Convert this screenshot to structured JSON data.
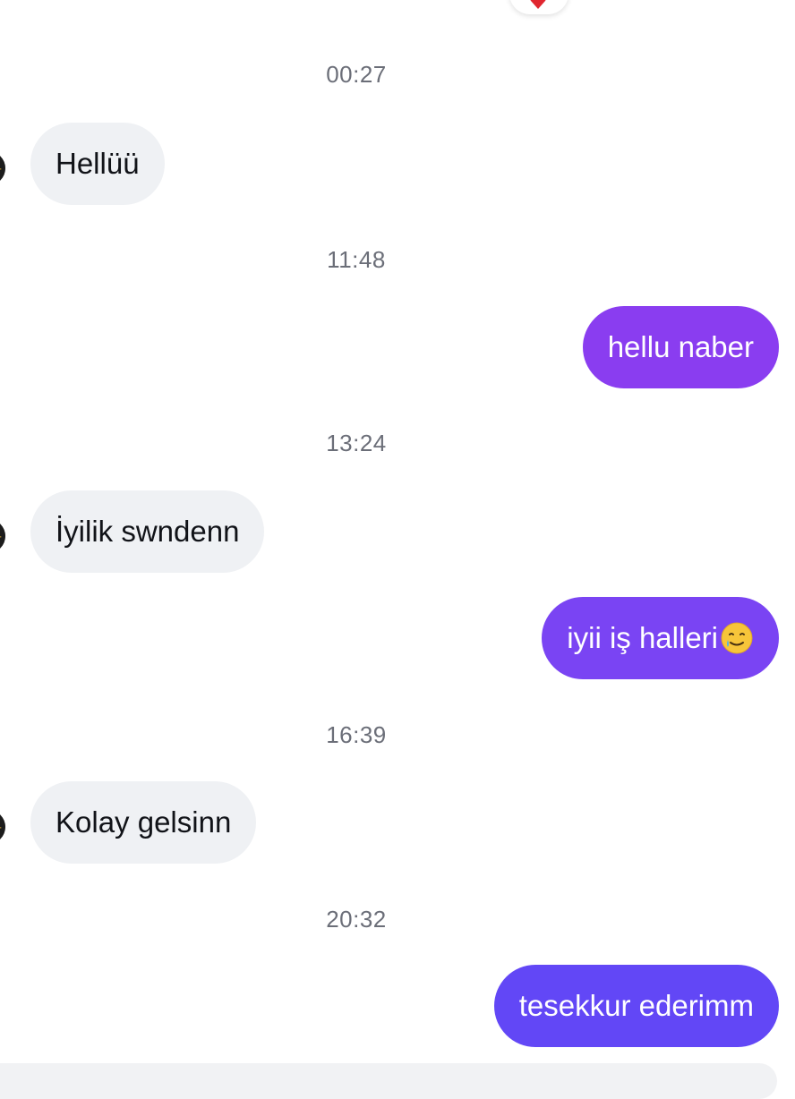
{
  "conversation": {
    "items": [
      {
        "type": "timestamp",
        "text": "00:27"
      },
      {
        "type": "incoming",
        "text": "Hellüü"
      },
      {
        "type": "timestamp",
        "text": "11:48"
      },
      {
        "type": "outgoing",
        "text": "hellu naber"
      },
      {
        "type": "timestamp",
        "text": "13:24"
      },
      {
        "type": "incoming",
        "text": "İyilik swndenn"
      },
      {
        "type": "outgoing",
        "text": "iyii iş halleri",
        "emoji": "smiling-face-with-tear"
      },
      {
        "type": "timestamp",
        "text": "16:39"
      },
      {
        "type": "incoming",
        "text": "Kolay gelsinn"
      },
      {
        "type": "timestamp",
        "text": "20:32"
      },
      {
        "type": "outgoing",
        "text": "tesekkur ederimm"
      }
    ],
    "reaction": {
      "icon": "heart-icon",
      "color": "#e0262f"
    }
  },
  "colors": {
    "incoming_bubble": "#eff1f4",
    "incoming_text": "#111318",
    "outgoing_gradient_1": "#8a3df0",
    "outgoing_gradient_2": "#7a44f3",
    "outgoing_gradient_3": "#6247f6",
    "timestamp_text": "#6b6e78"
  }
}
